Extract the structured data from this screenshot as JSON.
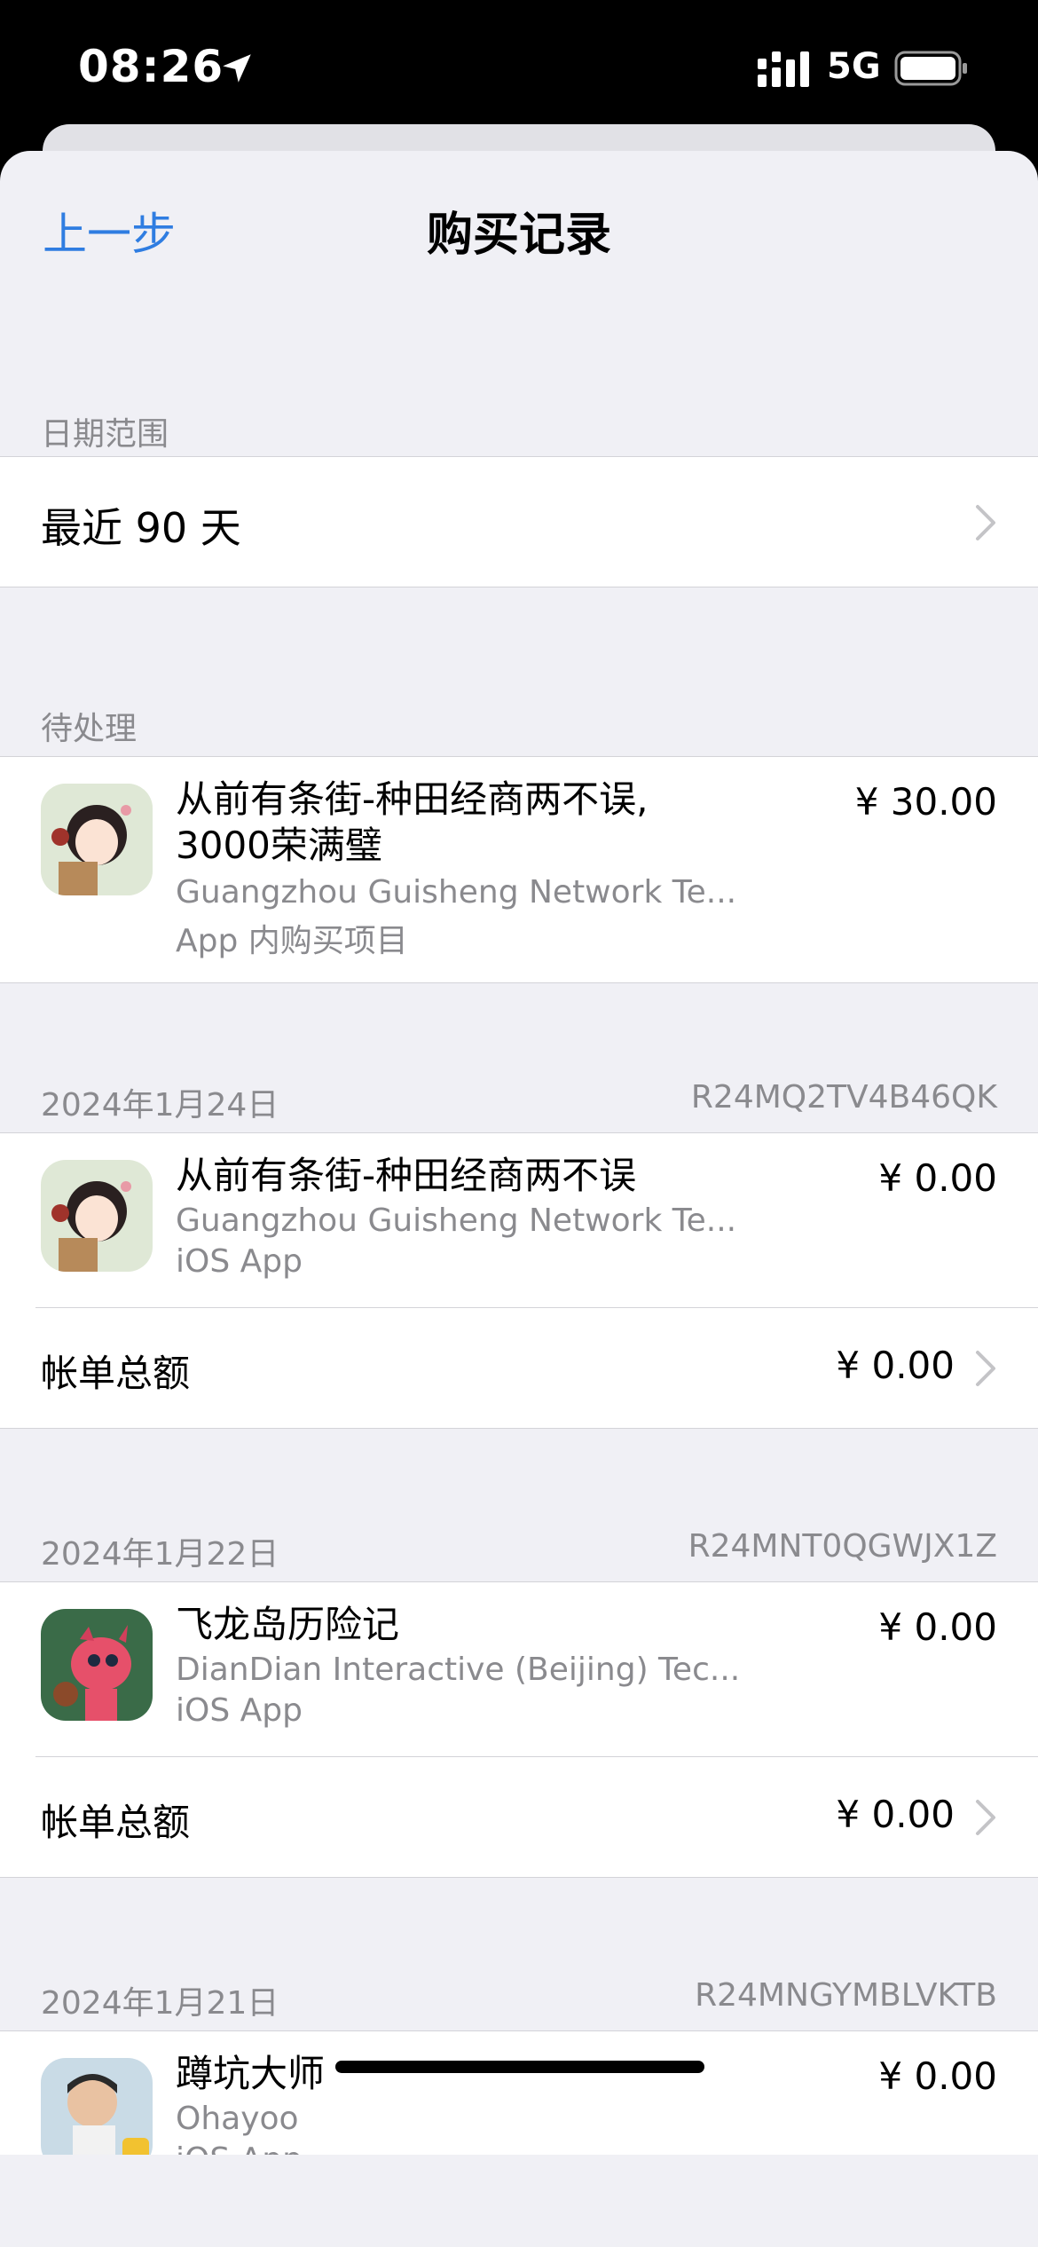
{
  "status_bar": {
    "time": "08:26",
    "network": "5G",
    "location_icon": "location-arrow-icon",
    "signal_icon": "cellular-signal-icon",
    "battery_icon": "battery-icon"
  },
  "nav": {
    "back_label": "上一步",
    "title": "购买记录"
  },
  "date_range": {
    "header": "日期范围",
    "value": "最近 90 天"
  },
  "pending": {
    "header": "待处理",
    "item": {
      "title_line1": "从前有条街-种田经商两不误,",
      "title_line2": "3000荣满璧",
      "developer": "Guangzhou Guisheng Network Te...",
      "kind": "App 内购买项目",
      "price": "¥ 30.00"
    }
  },
  "orders": [
    {
      "date": "2024年1月24日",
      "order_id": "R24MQ2TV4B46QK",
      "item": {
        "title": "从前有条街-种田经商两不误",
        "developer": "Guangzhou Guisheng Network Te...",
        "kind": "iOS App",
        "price": "¥ 0.00"
      },
      "total_label": "帐单总额",
      "total_value": "¥ 0.00"
    },
    {
      "date": "2024年1月22日",
      "order_id": "R24MNT0QGWJX1Z",
      "item": {
        "title": "飞龙岛历险记",
        "developer": "DianDian Interactive (Beijing) Tec...",
        "kind": "iOS App",
        "price": "¥ 0.00"
      },
      "total_label": "帐单总额",
      "total_value": "¥ 0.00"
    },
    {
      "date": "2024年1月21日",
      "order_id": "R24MNGYMBLVKTB",
      "item": {
        "title": "蹲坑大师",
        "developer": "Ohayoo",
        "kind": "iOS App",
        "price": "¥ 0.00"
      }
    }
  ],
  "colors": {
    "accent": "#2f7de1",
    "background": "#f0f0f5",
    "secondary_text": "#8a8a8e"
  }
}
